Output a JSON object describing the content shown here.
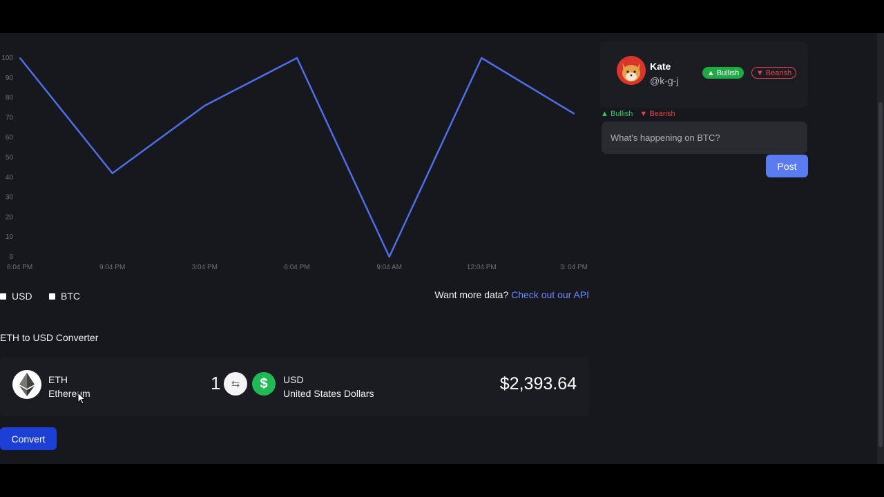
{
  "chart_data": {
    "type": "line",
    "x": [
      "6:04 PM",
      "9:04 PM",
      "3:04 PM",
      "6:04 PM",
      "9:04 AM",
      "12:04 PM",
      "3: 04 PM"
    ],
    "series": [
      {
        "values": [
          100,
          42,
          76,
          100,
          0,
          100,
          72
        ]
      }
    ],
    "yticks": [
      0,
      10,
      20,
      30,
      40,
      50,
      60,
      70,
      80,
      90,
      100
    ],
    "ylim": [
      0,
      100
    ],
    "line_color": "#4f6fe8",
    "grid": false
  },
  "filters": {
    "usd_label": "USD",
    "btc_label": "BTC"
  },
  "api": {
    "prompt": "Want more data?",
    "link_text": "Check out our API"
  },
  "converter": {
    "title": "ETH to USD Converter",
    "from_symbol": "ETH",
    "from_name": "Ethereum",
    "amount": "1",
    "to_symbol": "USD",
    "to_name": "United States Dollars",
    "dollar_glyph": "$",
    "result": "$2,393.64",
    "convert_label": "Convert"
  },
  "profile": {
    "name": "Kate",
    "handle": "@k-g-j",
    "bullish_label": "Bullish",
    "bearish_label": "Bearish"
  },
  "post": {
    "bullish_label": "Bullish",
    "bearish_label": "Bearish",
    "placeholder": "What's happening on BTC?",
    "post_label": "Post"
  },
  "colors": {
    "accent": "#5b7cf0",
    "bullish": "#1faa45",
    "bearish": "#e2444e",
    "convert": "#1c3fd6"
  }
}
